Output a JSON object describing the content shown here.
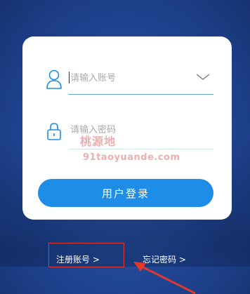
{
  "login_form": {
    "account_placeholder": "请输入账号",
    "password_placeholder": "请输入密码",
    "login_button_label": "用户登录"
  },
  "links": {
    "register_label": "注册账号 >",
    "forgot_password_label": "忘记密码 >"
  },
  "watermark": {
    "name": "桃源地",
    "url": "91taoyuande.com"
  },
  "icons": {
    "account": "user-icon",
    "password": "lock-icon",
    "dropdown": "chevron-down-icon"
  },
  "colors": {
    "background": "#234a9a",
    "primary_button": "#1e8de8",
    "input_underline": "#5aa7dc",
    "annotation": "#e23a2a"
  }
}
